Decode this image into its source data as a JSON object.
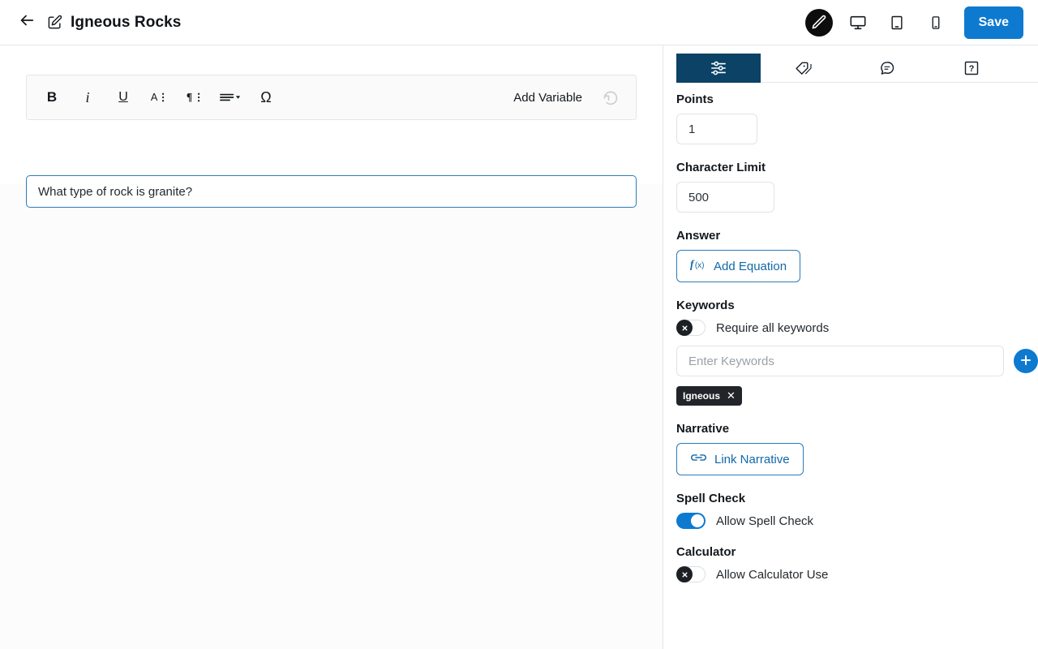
{
  "topbar": {
    "back_icon": "arrow-left-icon",
    "edit_icon": "pencil-square-icon",
    "title": "Igneous Rocks",
    "devices": [
      {
        "name": "pencil-icon",
        "active": true
      },
      {
        "name": "desktop-icon",
        "active": false
      },
      {
        "name": "tablet-icon",
        "active": false
      },
      {
        "name": "mobile-icon",
        "active": false
      }
    ],
    "save_label": "Save"
  },
  "editor": {
    "toolbar": [
      {
        "name": "bold-icon",
        "glyph": "B"
      },
      {
        "name": "italic-icon",
        "glyph": "i"
      },
      {
        "name": "underline-icon",
        "glyph": "U"
      },
      {
        "name": "text-style-icon",
        "glyph": "A"
      },
      {
        "name": "paragraph-style-icon",
        "glyph": "¶"
      },
      {
        "name": "align-list-icon",
        "glyph": "≡"
      },
      {
        "name": "special-character-icon",
        "glyph": "Ω"
      }
    ],
    "add_variable_label": "Add Variable",
    "undo_icon": "undo-icon",
    "question_text": "What type of rock is granite?"
  },
  "panel": {
    "tabs": [
      {
        "name": "tab-settings",
        "icon": "sliders-icon",
        "active": true
      },
      {
        "name": "tab-tags",
        "icon": "tag-icon",
        "active": false
      },
      {
        "name": "tab-comments",
        "icon": "comment-icon",
        "active": false
      },
      {
        "name": "tab-help",
        "icon": "help-box-icon",
        "active": false
      }
    ],
    "points": {
      "label": "Points",
      "value": "1"
    },
    "character_limit": {
      "label": "Character Limit",
      "value": "500"
    },
    "answer": {
      "label": "Answer",
      "button_label": "Add Equation",
      "button_icon": "function-icon"
    },
    "keywords": {
      "label": "Keywords",
      "require_all_label": "Require all keywords",
      "require_all_on": false,
      "input_placeholder": "Enter Keywords",
      "input_value": "",
      "add_icon": "plus-icon",
      "chips": [
        {
          "label": "Igneous",
          "remove_icon": "close-icon"
        }
      ]
    },
    "narrative": {
      "label": "Narrative",
      "button_label": "Link Narrative",
      "button_icon": "link-icon"
    },
    "spell_check": {
      "label": "Spell Check",
      "toggle_label": "Allow Spell Check",
      "on": true
    },
    "calculator": {
      "label": "Calculator",
      "toggle_label": "Allow Calculator Use",
      "on": false
    }
  },
  "colors": {
    "accent_blue": "#0d7ad0",
    "tab_active": "#0b4266",
    "chip_dark": "#212529",
    "field_focus": "#2b7cb8"
  }
}
